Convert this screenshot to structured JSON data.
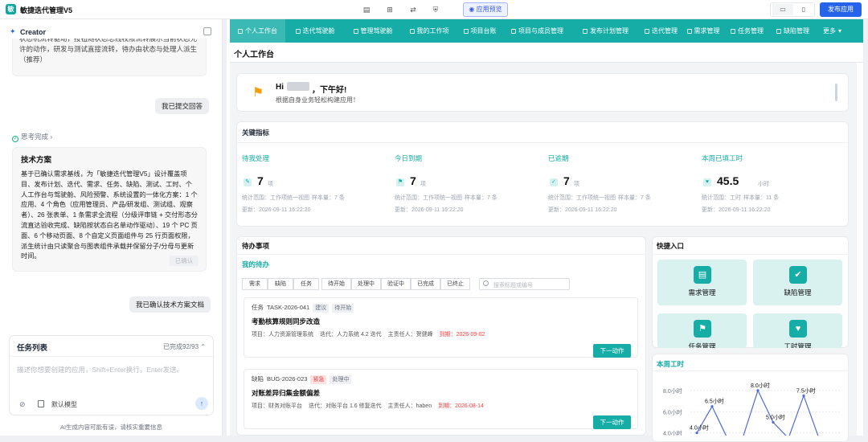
{
  "app": {
    "logo": "敏",
    "title": "敏捷迭代管理V5"
  },
  "toolbar": {
    "preview_label": "应用预览",
    "publish_label": "发布应用",
    "icons": [
      "doc-icon",
      "code-icon",
      "flow-icon",
      "shield-icon"
    ]
  },
  "chat": {
    "title": "Creator",
    "intro_text": "状态机流转驱动，按钮随状态总线权限流转展示当前状态允许的动作，研发与测试直接流转，待办由状态与处理人派生（推荐）",
    "user_msg_1": "我已提交回答",
    "think_label": "思考完成",
    "plan_title": "技术方案",
    "plan_body": "基于已确认需求基线，为「敏捷迭代管理V5」设计覆盖项目、发布计划、迭代、需求、任务、缺陷、测试、工时、个人工作台与驾驶舱、风险预警、系统设置的一体化方案：1 个应用、4 个角色（应用管理员、产品/研发组、测试组、观察者）、26 张表单、1 条需求全流程（分级评审链 + 交付形态分流直达验收完成、缺陷按状态白名单动作驱动）、19 个 PC 页面、6 个移动页面、8 个自定义页面组件与 25 行页面权限，派生统计由只读聚合与图表组件承载并保留分子/分母与更新时间。",
    "confirmed_tag": "已确认",
    "user_msg_2": "我已确认技术方案文档"
  },
  "tasklist": {
    "title": "任务列表",
    "progress": "已完成92/93",
    "placeholder": "描述你想要创建的应用，Shift+Enter换行，Enter发送。",
    "model_label": "默认模型",
    "disclaimer": "AI生成内容可能有误，请核实重要信息"
  },
  "nav": {
    "items": [
      "个人工作台",
      "迭代驾驶舱",
      "管理驾驶舱",
      "我的工作项",
      "项目台账",
      "项目与成员管理",
      "发布计划管理",
      "迭代管理",
      "需求管理",
      "任务管理",
      "缺陷管理"
    ],
    "more": "更多"
  },
  "page": {
    "title": "个人工作台"
  },
  "welcome": {
    "hi": "Hi",
    "greeting": "，下午好!",
    "subtitle": "根据自身业务轻松构建应用！"
  },
  "kpi": {
    "title": "关键指标",
    "items": [
      {
        "label": "待我处理",
        "value": "7",
        "unit": "项",
        "scope": "统计范围：工作项统一视图",
        "sample": "样本量：7 条",
        "updated": "更新：2026-09-11 16:22:20"
      },
      {
        "label": "今日到期",
        "value": "7",
        "unit": "项",
        "scope": "统计范围：工作项统一视图",
        "sample": "样本量：7 条",
        "updated": "更新：2026-09-11 16:22:20"
      },
      {
        "label": "已逾期",
        "value": "7",
        "unit": "项",
        "scope": "统计范围：工作项统一视图",
        "sample": "样本量：7 条",
        "updated": "更新：2026-09-11 16:22:20"
      },
      {
        "label": "本周已填工时",
        "value": "45.5",
        "unit": "小时",
        "scope": "统计范围：工时",
        "sample": "样本量：11 条",
        "updated": "更新：2026-09-11 16:22:20"
      }
    ]
  },
  "todo": {
    "title": "待办事项",
    "subtitle": "我的待办",
    "type_filters": [
      "需求",
      "缺陷",
      "任务"
    ],
    "status_filters": [
      "待开始",
      "处理中",
      "验证中",
      "已完成",
      "已终止"
    ],
    "search_placeholder": "搜索标题或编号",
    "cards": [
      {
        "type": "任务",
        "code": "TASK-2026-041",
        "tags": [
          "建议",
          "待开始"
        ],
        "title": "考勤核算规则同步改造",
        "project": "项目：人力资源管理系统",
        "iteration": "迭代：人力系统 4.2 迭代",
        "owner": "主责任人：贺健峰",
        "due": "到期：2026-09-02",
        "action": "下一动作"
      },
      {
        "type": "缺陷",
        "code": "BUG-2026-023",
        "tags": [
          "紧急",
          "处理中"
        ],
        "title": "对账差异归集金额偏差",
        "project": "项目：财务对账平台",
        "iteration": "迭代：对账平台 1.6 修复迭代",
        "owner": "主责任人：haben",
        "due": "到期：2026-08-14",
        "action": "下一动作"
      }
    ]
  },
  "quick": {
    "title": "快捷入口",
    "items": [
      "需求管理",
      "缺陷管理",
      "任务管理",
      "工时管理"
    ]
  },
  "chart_data": {
    "type": "line",
    "title": "本周工时",
    "ylabel": "",
    "xlabel": "",
    "yticks": [
      "8.0小时",
      "6.0小时",
      "4.0小时"
    ],
    "ylim": [
      3.5,
      9
    ],
    "series": [
      {
        "values": [
          4.0,
          6.5,
          3.5,
          3.5,
          8.0,
          5.0,
          3.5,
          7.5,
          3.5
        ]
      }
    ],
    "point_labels": [
      "4.0小时",
      "6.5小时",
      "",
      "",
      "8.0小时",
      "5.0小时",
      "",
      "7.5小时",
      ""
    ],
    "grid": true,
    "color": "#4f6bd8"
  }
}
